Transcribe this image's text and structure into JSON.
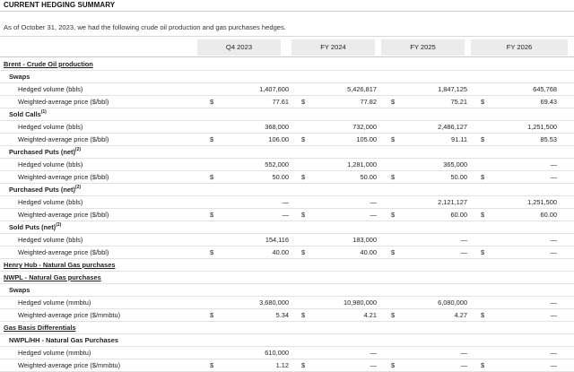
{
  "title": "CURRENT HEDGING SUMMARY",
  "intro": "As of October 31, 2023, we had the following crude oil production and gas purchases hedges.",
  "columns": [
    "Q4 2023",
    "FY 2024",
    "FY 2025",
    "FY 2026"
  ],
  "rows": [
    {
      "label": "Brent - Crude Oil production",
      "kind": "section",
      "cells": []
    },
    {
      "label": "Swaps",
      "kind": "sub",
      "cells": []
    },
    {
      "label": "Hedged volume (bbls)",
      "kind": "item",
      "cells": [
        [
          "",
          "1,407,600"
        ],
        [
          "",
          "5,426,817"
        ],
        [
          "",
          "1,847,125"
        ],
        [
          "",
          "645,768"
        ]
      ]
    },
    {
      "label": "Weighted-average price ($/bbl)",
      "kind": "item",
      "cells": [
        [
          "$",
          "77.61"
        ],
        [
          "$",
          "77.82"
        ],
        [
          "$",
          "75.21"
        ],
        [
          "$",
          "69.43"
        ]
      ]
    },
    {
      "label": "Sold Calls",
      "sup": "(1)",
      "kind": "sub",
      "cells": []
    },
    {
      "label": "Hedged volume (bbls)",
      "kind": "item",
      "cells": [
        [
          "",
          "368,000"
        ],
        [
          "",
          "732,000"
        ],
        [
          "",
          "2,486,127"
        ],
        [
          "",
          "1,251,500"
        ]
      ]
    },
    {
      "label": "Weighted-average price ($/bbl)",
      "kind": "item",
      "cells": [
        [
          "$",
          "106.00"
        ],
        [
          "$",
          "105.00"
        ],
        [
          "$",
          "91.11"
        ],
        [
          "$",
          "85.53"
        ]
      ]
    },
    {
      "label": "Purchased Puts (net)",
      "sup": "(2)",
      "kind": "sub",
      "cells": []
    },
    {
      "label": "Hedged volume (bbls)",
      "kind": "item",
      "cells": [
        [
          "",
          "552,000"
        ],
        [
          "",
          "1,281,000"
        ],
        [
          "",
          "365,000"
        ],
        [
          "",
          "—"
        ]
      ]
    },
    {
      "label": "Weighted-average price ($/bbl)",
      "kind": "item",
      "cells": [
        [
          "$",
          "50.00"
        ],
        [
          "$",
          "50.00"
        ],
        [
          "$",
          "50.00"
        ],
        [
          "$",
          "—"
        ]
      ]
    },
    {
      "label": "Purchased Puts (net)",
      "sup": "(2)",
      "kind": "sub",
      "cells": []
    },
    {
      "label": "Hedged volume (bbls)",
      "kind": "item",
      "cells": [
        [
          "",
          "—"
        ],
        [
          "",
          "—"
        ],
        [
          "",
          "2,121,127"
        ],
        [
          "",
          "1,251,500"
        ]
      ]
    },
    {
      "label": "Weighted-average price ($/bbl)",
      "kind": "item",
      "cells": [
        [
          "$",
          "—"
        ],
        [
          "$",
          "—"
        ],
        [
          "$",
          "60.00"
        ],
        [
          "$",
          "60.00"
        ]
      ]
    },
    {
      "label": "Sold Puts (net)",
      "sup": "(2)",
      "kind": "sub",
      "cells": []
    },
    {
      "label": "Hedged volume (bbls)",
      "kind": "item",
      "cells": [
        [
          "",
          "154,116"
        ],
        [
          "",
          "183,000"
        ],
        [
          "",
          "—"
        ],
        [
          "",
          "—"
        ]
      ]
    },
    {
      "label": "Weighted-average price ($/bbl)",
      "kind": "item",
      "cells": [
        [
          "$",
          "40.00"
        ],
        [
          "$",
          "40.00"
        ],
        [
          "$",
          "—"
        ],
        [
          "$",
          "—"
        ]
      ]
    },
    {
      "label": "Henry Hub - Natural Gas purchases",
      "kind": "section",
      "cells": []
    },
    {
      "label": "NWPL - Natural Gas purchases",
      "kind": "section",
      "cells": []
    },
    {
      "label": "Swaps",
      "kind": "sub",
      "cells": []
    },
    {
      "label": "Hedged volume (mmbtu)",
      "kind": "item",
      "cells": [
        [
          "",
          "3,680,000"
        ],
        [
          "",
          "10,980,000"
        ],
        [
          "",
          "6,080,000"
        ],
        [
          "",
          "—"
        ]
      ]
    },
    {
      "label": "Weighted-average price ($/mmbtu)",
      "kind": "item",
      "cells": [
        [
          "$",
          "5.34"
        ],
        [
          "$",
          "4.21"
        ],
        [
          "$",
          "4.27"
        ],
        [
          "$",
          "—"
        ]
      ]
    },
    {
      "label": "Gas Basis Differentials",
      "kind": "section",
      "cells": []
    },
    {
      "label": "NWPL/HH - Natural Gas Purchases",
      "kind": "sub",
      "cells": []
    },
    {
      "label": "Hedged volume (mmbtu)",
      "kind": "item",
      "cells": [
        [
          "",
          "610,000"
        ],
        [
          "",
          "—"
        ],
        [
          "",
          "—"
        ],
        [
          "",
          "—"
        ]
      ]
    },
    {
      "label": "Weighted-average price ($/mmbtu)",
      "kind": "item",
      "cells": [
        [
          "$",
          "1.12"
        ],
        [
          "$",
          "—"
        ],
        [
          "$",
          "—"
        ],
        [
          "$",
          "—"
        ]
      ]
    }
  ]
}
